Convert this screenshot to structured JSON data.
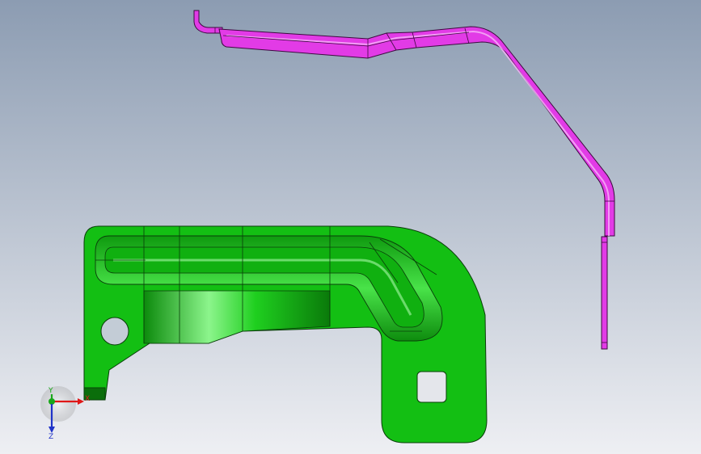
{
  "viewport": {
    "background_top": "#8c9cb2",
    "background_bottom": "#eeeff3"
  },
  "parts": {
    "green_part": {
      "color": "#13bf13",
      "edge_color": "#0a3d0a"
    },
    "magenta_part": {
      "color": "#e23be6",
      "edge_color": "#3d0a40"
    }
  },
  "triad": {
    "x_label": "X",
    "y_label": "Y",
    "z_label": "Z",
    "x_color": "#e01818",
    "y_color": "#1aa81a",
    "z_color": "#1f33c8"
  }
}
